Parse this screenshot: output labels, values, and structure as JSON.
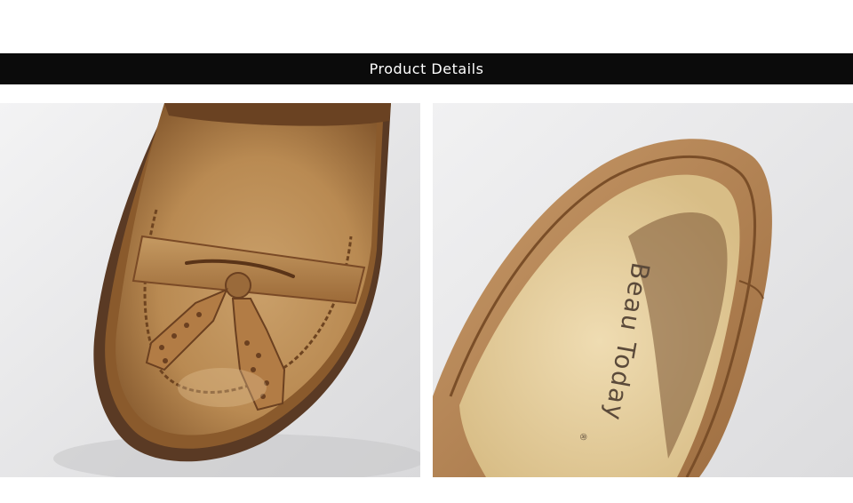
{
  "header": {
    "title": "Product Details"
  },
  "photos": [
    {
      "name": "tassel-loafer-toe-closeup",
      "colors": {
        "background": "#e9e9ea",
        "leather": "#b98a52",
        "leather_dark": "#8a5a2c",
        "sole": "#5a3a24",
        "welt": "#7a4a26"
      },
      "icons": [
        "tassel-icon"
      ]
    },
    {
      "name": "loafer-insole-closeup",
      "insole_brand": "Beau Today",
      "registered_mark": "®",
      "colors": {
        "background": "#ebebec",
        "insole": "#e6cf9f",
        "leather": "#b58555",
        "brand_text": "#5b4a3a"
      }
    }
  ]
}
